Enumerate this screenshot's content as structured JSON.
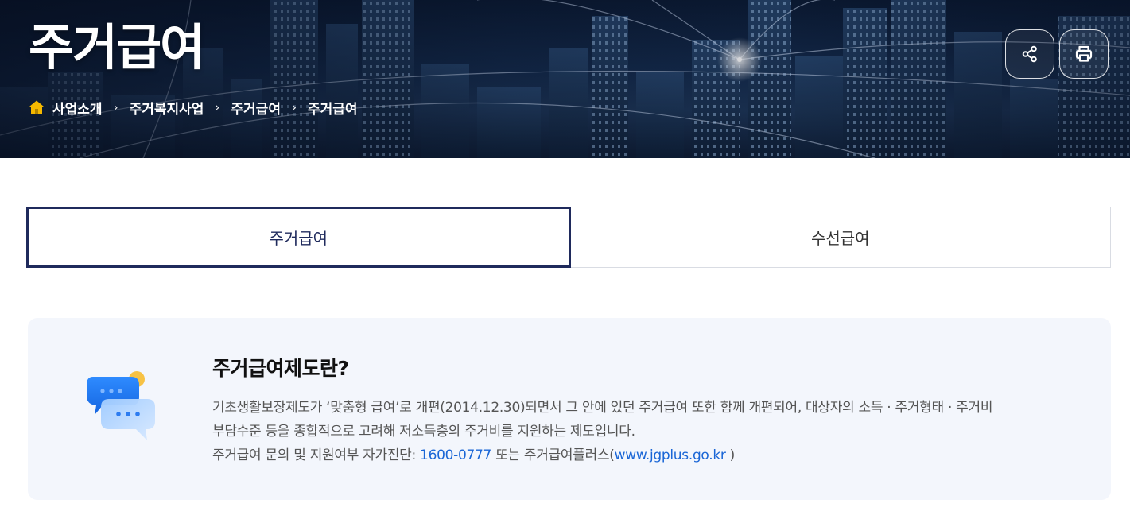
{
  "header": {
    "title": "주거급여",
    "breadcrumb": [
      "사업소개",
      "주거복지사업",
      "주거급여",
      "주거급여"
    ],
    "icons": {
      "home": "home-icon",
      "share": "share-icon",
      "print": "printer-icon"
    }
  },
  "tabs": [
    {
      "label": "주거급여",
      "active": true
    },
    {
      "label": "수선급여",
      "active": false
    }
  ],
  "info": {
    "icon": "chat-bubbles-icon",
    "heading": "주거급여제도란?",
    "line1": "기초생활보장제도가 ‘맞춤형 급여’로 개편(2014.12.30)되면서 그 안에 있던 주거급여 또한 함께 개편되어, 대상자의 소득 · 주거형태 · 주거비",
    "line2": "부담수준 등을 종합적으로 고려해 저소득층의 주거비를 지원하는 제도입니다.",
    "line3_prefix": "주거급여 문의 및 지원여부 자가진단: ",
    "phone": "1600-0777",
    "line3_middle": " 또는 주거급여플러스(",
    "website": "www.jgplus.go.kr",
    "line3_suffix": " )"
  },
  "colors": {
    "active_tab_border": "#1f2a5c",
    "link": "#1a66d6",
    "info_bg": "#f3f6fc",
    "home_icon": "#f5b800"
  }
}
